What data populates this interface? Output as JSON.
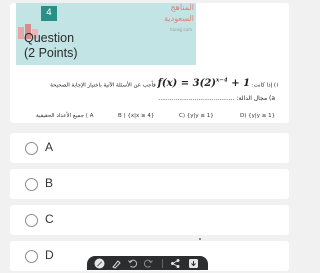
{
  "question": {
    "number": "4",
    "logo_line1": "المناهج",
    "logo_line2": "السعودية",
    "logo_tagline": "hanajj.com",
    "title": "Question",
    "points": "(2 Points)",
    "text_prefix": "١) إذا كانت:",
    "formula": "f(x) = 3(2)",
    "formula_exponent": "x−4",
    "formula_tail": " + 1",
    "text_suffix": "فأجب عن الأسئلة الآتية  باختيار الإجابة الصحيحة",
    "sub_label": "a)  مجال الدالة: ........................................",
    "choices": [
      "A ) جميع الأعداد الحقيقية",
      "B ) {x|x ≥ 4}",
      "C)  {y|y ≤ 1}",
      "D) {y|y ≥ 1}"
    ]
  },
  "options": [
    {
      "label": "A"
    },
    {
      "label": "B"
    },
    {
      "label": "C"
    },
    {
      "label": "D"
    }
  ],
  "toolbar": {
    "icons": [
      "pen-icon",
      "highlighter-icon",
      "undo-icon",
      "redo-icon",
      "share-icon",
      "download-icon"
    ]
  },
  "colors": {
    "header_bg": "#c2e4e4",
    "badge": "#2a8f86",
    "logo": "#d98080",
    "toolbar": "#2b2d2f"
  }
}
